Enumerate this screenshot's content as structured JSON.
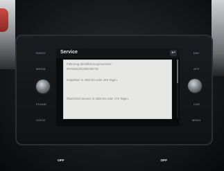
{
  "screen": {
    "title": "Service",
    "back_label": "↩",
    "lines": [
      "Fahrzeug-Identifizierungsnummer:",
      "WVWZZZ3CWE035720",
      "Inspektion in 4200 km oder 493 Tagen.",
      "Ölwechsel-Service in 3500 km oder 476 Tagen."
    ]
  },
  "left_buttons": [
    {
      "label": "RADIO"
    },
    {
      "label": "MEDIA"
    },
    {
      "label": "PHONE"
    },
    {
      "label": "VOICE"
    }
  ],
  "right_buttons": [
    {
      "label": "NAV"
    },
    {
      "label": "APP"
    },
    {
      "label": "CAR"
    },
    {
      "label": "MENU"
    }
  ],
  "climate": {
    "left": "OFF",
    "right": "OFF"
  }
}
